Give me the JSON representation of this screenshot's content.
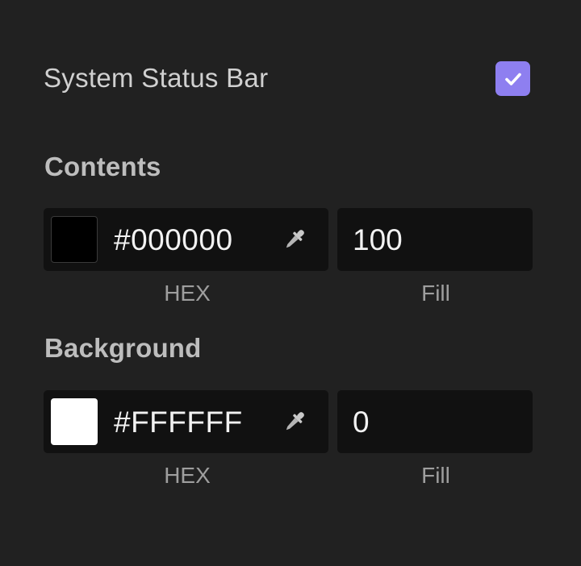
{
  "system_status_bar": {
    "label": "System Status Bar",
    "checked": true,
    "checkbox_color": "#8e7ff0",
    "check_icon": "checkmark-icon"
  },
  "contents": {
    "title": "Contents",
    "swatch_color": "#000000",
    "hex_value": "#000000",
    "fill_value": "100",
    "hex_label": "HEX",
    "fill_label": "Fill",
    "picker_icon": "eyedropper-icon"
  },
  "background": {
    "title": "Background",
    "swatch_color": "#FFFFFF",
    "hex_value": "#FFFFFF",
    "fill_value": "0",
    "hex_label": "HEX",
    "fill_label": "Fill",
    "picker_icon": "eyedropper-icon"
  }
}
